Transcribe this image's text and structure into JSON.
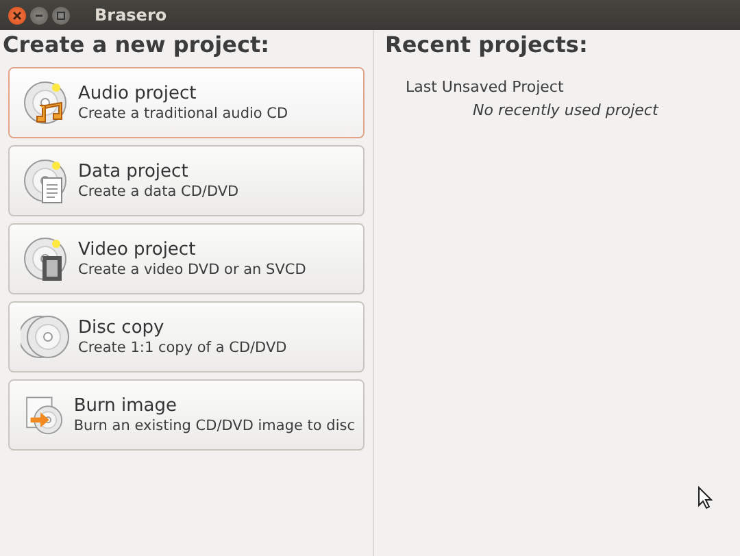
{
  "window": {
    "title": "Brasero"
  },
  "new_project": {
    "heading": "Create a new project:",
    "items": [
      {
        "kind": "audio",
        "title": "Audio project",
        "description": "Create a traditional audio CD",
        "selected": true
      },
      {
        "kind": "data",
        "title": "Data project",
        "description": "Create a data CD/DVD",
        "selected": false
      },
      {
        "kind": "video",
        "title": "Video project",
        "description": "Create a video DVD or an SVCD",
        "selected": false
      },
      {
        "kind": "copy",
        "title": "Disc copy",
        "description": "Create 1:1 copy of a CD/DVD",
        "selected": false
      },
      {
        "kind": "image",
        "title": "Burn image",
        "description": "Burn an existing CD/DVD image to disc",
        "selected": false
      }
    ]
  },
  "recent_projects": {
    "heading": "Recent projects:",
    "items": [
      {
        "label": "Last Unsaved Project"
      }
    ],
    "empty_message": "No recently used project"
  }
}
